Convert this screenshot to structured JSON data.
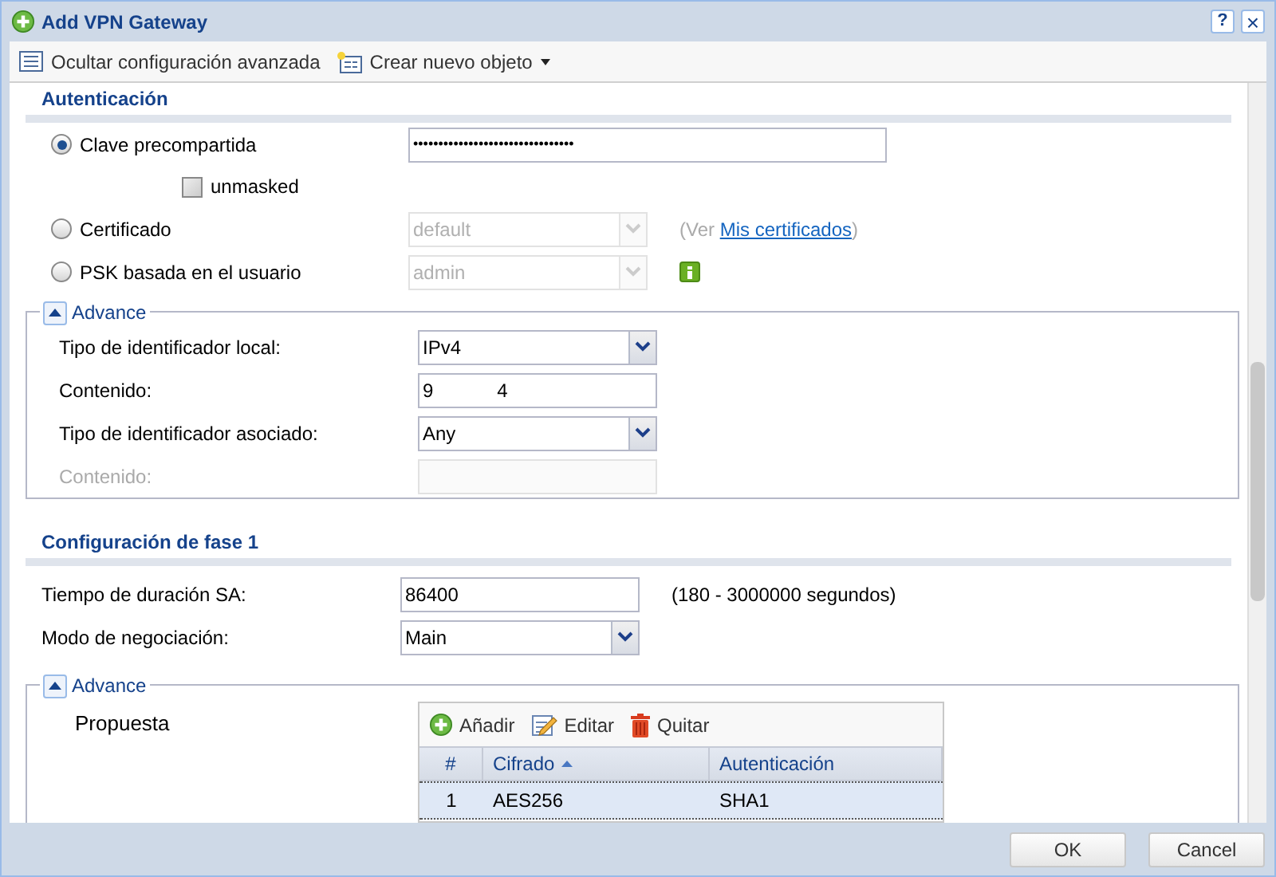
{
  "window": {
    "title": "Add VPN Gateway",
    "help": "?",
    "close": "×"
  },
  "toolbar": [
    {
      "kind": "list",
      "label": "Ocultar configuración avanzada"
    },
    {
      "kind": "new",
      "label": "Crear nuevo objeto",
      "dropdown": true
    }
  ],
  "auth": {
    "title": "Autenticación",
    "options": [
      {
        "label": "Clave precompartida",
        "selected": true,
        "kind": "password",
        "disabled": false,
        "value": "••••••••••••••••••••••••••••••••"
      },
      {
        "label": "Certificado",
        "selected": false,
        "kind": "select",
        "value": "default",
        "disabled": true,
        "note": "(Ver ",
        "link": "Mis certificados",
        "note_end": ")"
      },
      {
        "label": "PSK basada en el usuario",
        "selected": false,
        "kind": "select",
        "value": "admin",
        "disabled": true,
        "info": true
      }
    ],
    "unmasked": {
      "label": "unmasked",
      "checked": false
    }
  },
  "advance1": {
    "title": "Advance",
    "expanded": true,
    "rows": [
      {
        "label": "Tipo de identificador local:",
        "kind": "select",
        "value": "IPv4",
        "disabled": false
      },
      {
        "label": "Contenido:",
        "kind": "text",
        "value": "9            4",
        "disabled": false
      },
      {
        "label": "Tipo de identificador asociado:",
        "kind": "select",
        "value": "Any",
        "disabled": false
      },
      {
        "label": "Contenido:",
        "kind": "text",
        "value": "",
        "disabled": true
      }
    ]
  },
  "phase1": {
    "title": "Configuración de fase 1",
    "rows": [
      {
        "label": "Tiempo de duración SA:",
        "kind": "text",
        "value": "86400",
        "disabled": false,
        "hint": "(180 - 3000000 segundos)"
      },
      {
        "label": "Modo de negociación:",
        "kind": "select",
        "value": "Main",
        "disabled": false
      }
    ]
  },
  "advance2": {
    "title": "Advance",
    "expanded": true,
    "label": "Propuesta",
    "actions": [
      {
        "kind": "add",
        "label": "Añadir"
      },
      {
        "kind": "edit",
        "label": "Editar"
      },
      {
        "kind": "delete",
        "label": "Quitar"
      }
    ],
    "table": {
      "columns": [
        {
          "label": "#",
          "sorted": false
        },
        {
          "label": "Cifrado",
          "sorted": true
        },
        {
          "label": "Autenticación",
          "sorted": false
        }
      ],
      "rows": [
        {
          "selected": true,
          "cells": [
            "1",
            "AES256",
            "SHA1"
          ]
        }
      ]
    }
  },
  "buttons": [
    "OK",
    "Cancel"
  ]
}
